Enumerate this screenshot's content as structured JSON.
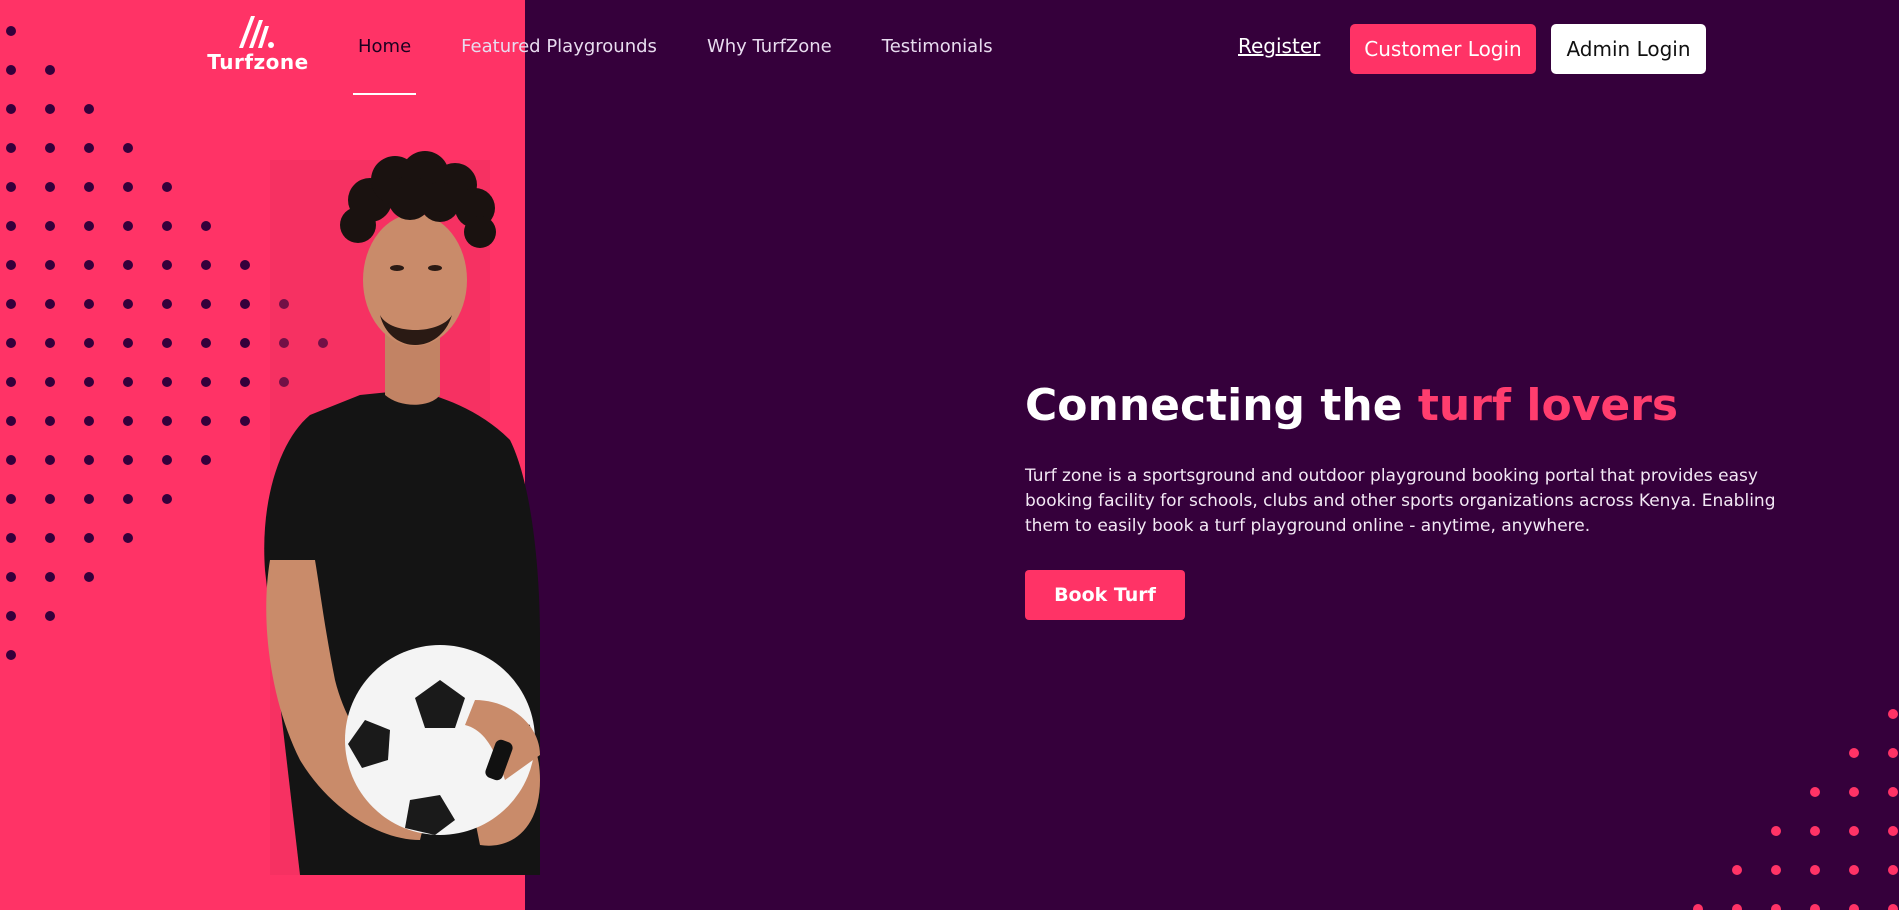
{
  "brand": {
    "name": "Turfzone",
    "logo_icon": "slash-stripes-logo-icon"
  },
  "nav": {
    "items": [
      {
        "label": "Home",
        "active": true
      },
      {
        "label": "Featured Playgrounds",
        "active": false
      },
      {
        "label": "Why TurfZone",
        "active": false
      },
      {
        "label": "Testimonials",
        "active": false
      }
    ]
  },
  "auth": {
    "register_label": "Register",
    "customer_login_label": "Customer Login",
    "admin_login_label": "Admin Login"
  },
  "hero": {
    "title_prefix": "Connecting the ",
    "title_accent": "turf lovers",
    "description": "Turf zone is a sportsground and outdoor playground booking portal that provides easy booking facility for schools, clubs and other sports organizations across Kenya. Enabling them to easily book a turf playground online - anytime, anywhere.",
    "cta_label": "Book Turf",
    "image": "young-man-holding-soccer-ball-photo"
  },
  "colors": {
    "primary_pink": "#ff3366",
    "background_purple": "#35003b",
    "dot_dark": "#35003b",
    "dot_pink": "#ff3366",
    "white": "#ffffff"
  }
}
